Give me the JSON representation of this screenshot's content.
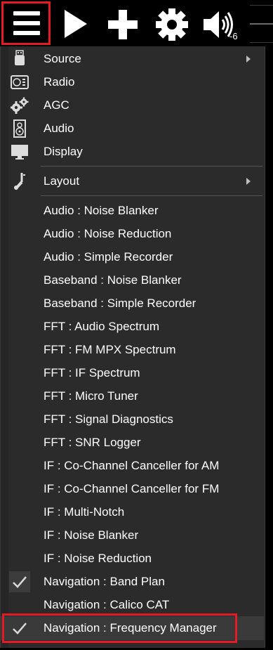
{
  "toolbar": {
    "menu_icon": "hamburger-icon",
    "play_icon": "play-icon",
    "add_icon": "plus-icon",
    "settings_icon": "gear-icon",
    "volume_icon": "speaker-icon",
    "volume_level": "-6",
    "highlight_color": "#e21b24"
  },
  "menu": {
    "top_items": [
      {
        "label": "Source",
        "icon": "usb-icon",
        "submenu": true
      },
      {
        "label": "Radio",
        "icon": "radio-icon",
        "submenu": false
      },
      {
        "label": "AGC",
        "icon": "gears-icon",
        "submenu": false
      },
      {
        "label": "Audio",
        "icon": "speaker-box-icon",
        "submenu": false
      },
      {
        "label": "Display",
        "icon": "monitor-icon",
        "submenu": false
      }
    ],
    "layout_item": {
      "label": "Layout",
      "icon": "tuning-fork-icon",
      "submenu": true
    },
    "plugins": [
      {
        "label": "Audio : Noise Blanker",
        "checked": false
      },
      {
        "label": "Audio : Noise Reduction",
        "checked": false
      },
      {
        "label": "Audio : Simple Recorder",
        "checked": false
      },
      {
        "label": "Baseband : Noise Blanker",
        "checked": false
      },
      {
        "label": "Baseband : Simple Recorder",
        "checked": false
      },
      {
        "label": "FFT : Audio Spectrum",
        "checked": false
      },
      {
        "label": "FFT : FM MPX Spectrum",
        "checked": false
      },
      {
        "label": "FFT : IF Spectrum",
        "checked": false
      },
      {
        "label": "FFT : Micro Tuner",
        "checked": false
      },
      {
        "label": "FFT : Signal Diagnostics",
        "checked": false
      },
      {
        "label": "FFT : SNR Logger",
        "checked": false
      },
      {
        "label": "IF : Co-Channel Canceller for AM",
        "checked": false
      },
      {
        "label": "IF : Co-Channel Canceller for FM",
        "checked": false
      },
      {
        "label": "IF : Multi-Notch",
        "checked": false
      },
      {
        "label": "IF : Noise Blanker",
        "checked": false
      },
      {
        "label": "IF : Noise Reduction",
        "checked": false
      },
      {
        "label": "Navigation : Band Plan",
        "checked": true
      },
      {
        "label": "Navigation : Calico CAT",
        "checked": false
      },
      {
        "label": "Navigation : Frequency Manager",
        "checked": true,
        "highlighted": true
      }
    ]
  }
}
